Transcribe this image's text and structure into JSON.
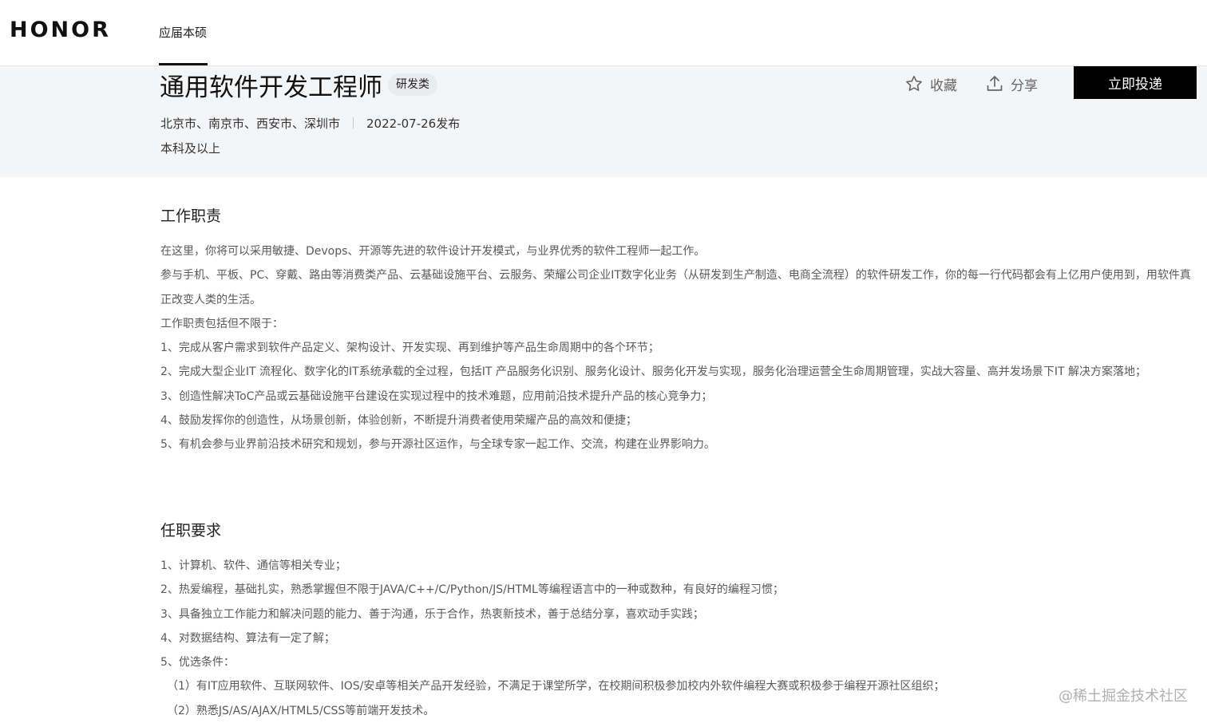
{
  "nav": {
    "logo": "HONOR",
    "link": "应届本硕"
  },
  "job": {
    "title": "通用软件开发工程师",
    "tag": "研发类",
    "locations": "北京市、南京市、西安市、深圳市",
    "published": "2022-07-26发布",
    "education": "本科及以上"
  },
  "actions": {
    "favorite": "收藏",
    "share": "分享",
    "apply": "立即投递",
    "favorite_icon": "star-icon",
    "share_icon": "upload-share-icon"
  },
  "responsibilities": {
    "title": "工作职责",
    "paragraphs": [
      "在这里，你将可以采用敏捷、Devops、开源等先进的软件设计开发模式，与业界优秀的软件工程师一起工作。",
      "参与手机、平板、PC、穿戴、路由等消费类产品、云基础设施平台、云服务、荣耀公司企业IT数字化业务（从研发到生产制造、电商全流程）的软件研发工作，你的每一行代码都会有上亿用户使用到，用软件真正改变人类的生活。",
      "工作职责包括但不限于：",
      "1、完成从客户需求到软件产品定义、架构设计、开发实现、再到维护等产品生命周期中的各个环节；",
      "2、完成大型企业IT 流程化、数字化的IT系统承载的全过程，包括IT 产品服务化识别、服务化设计、服务化开发与实现，服务化治理运营全生命周期管理，实战大容量、高并发场景下IT 解决方案落地；",
      "3、创造性解决ToC产品或云基础设施平台建设在实现过程中的技术难题，应用前沿技术提升产品的核心竞争力；",
      "4、鼓励发挥你的创造性，从场景创新，体验创新，不断提升消费者使用荣耀产品的高效和便捷；",
      "5、有机会参与业界前沿技术研究和规划，参与开源社区运作，与全球专家一起工作、交流，构建在业界影响力。"
    ]
  },
  "requirements": {
    "title": "任职要求",
    "paragraphs": [
      "1、计算机、软件、通信等相关专业；",
      "2、热爱编程，基础扎实，熟悉掌握但不限于JAVA/C++/C/Python/JS/HTML等编程语言中的一种或数种，有良好的编程习惯；",
      "3、具备独立工作能力和解决问题的能力、善于沟通，乐于合作，热衷新技术，善于总结分享，喜欢动手实践；",
      "4、对数据结构、算法有一定了解；",
      "5、优选条件：",
      "（1）有IT应用软件、互联网软件、IOS/安卓等相关产品开发经验，不满足于课堂所学，在校期间积极参加校内外软件编程大赛或积极参于编程开源社区组织；",
      "（2）熟悉JS/AS/AJAX/HTML5/CSS等前端开发技术。"
    ]
  },
  "watermark": "@稀土掘金技术社区"
}
